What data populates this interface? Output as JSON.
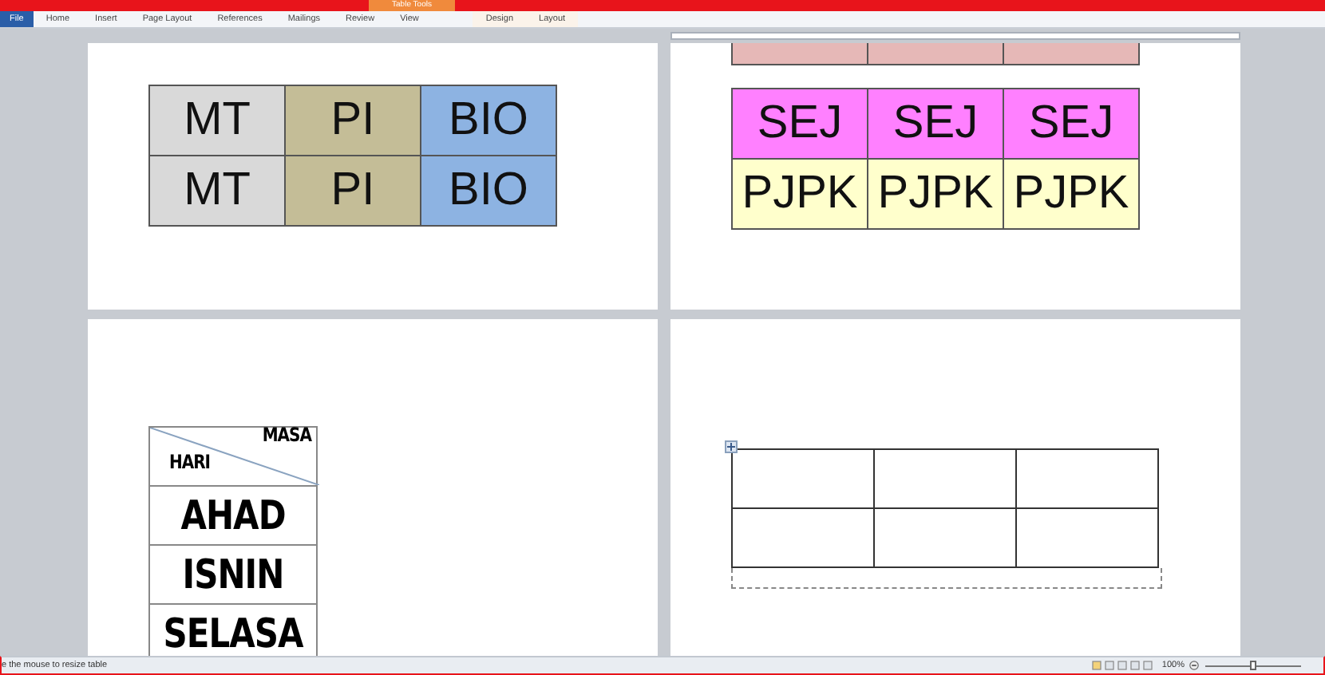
{
  "title_bar": {
    "context_group": "Table Tools"
  },
  "ribbon": {
    "tabs": [
      {
        "label": "File",
        "kind": "file",
        "selected": false
      },
      {
        "label": "Home",
        "kind": "normal",
        "selected": false
      },
      {
        "label": "Insert",
        "kind": "normal",
        "selected": false
      },
      {
        "label": "Page Layout",
        "kind": "normal",
        "selected": false
      },
      {
        "label": "References",
        "kind": "normal",
        "selected": false
      },
      {
        "label": "Mailings",
        "kind": "normal",
        "selected": false
      },
      {
        "label": "Review",
        "kind": "normal",
        "selected": false
      },
      {
        "label": "View",
        "kind": "normal",
        "selected": false
      },
      {
        "label": "Design",
        "kind": "contextual",
        "selected": false
      },
      {
        "label": "Layout",
        "kind": "contextual",
        "selected": false
      }
    ]
  },
  "pages": [
    {
      "tables": [
        {
          "kind": "large",
          "rows": [
            [
              {
                "kind": "text",
                "text": "MT",
                "color": "#d9d9d9"
              },
              {
                "kind": "text",
                "text": "PI",
                "color": "#c4bd97"
              },
              {
                "kind": "text",
                "text": "BIO",
                "color": "#8db3e2"
              }
            ],
            [
              {
                "kind": "text",
                "text": "MT",
                "color": "#d9d9d9"
              },
              {
                "kind": "text",
                "text": "PI",
                "color": "#c4bd97"
              },
              {
                "kind": "text",
                "text": "BIO",
                "color": "#8db3e2"
              }
            ]
          ]
        }
      ]
    },
    {
      "tables": [
        {
          "kind": "strip",
          "rows": [
            [
              {
                "kind": "empty",
                "color": "#e6b8b7"
              },
              {
                "kind": "empty",
                "color": "#e6b8b7"
              },
              {
                "kind": "empty",
                "color": "#e6b8b7"
              }
            ]
          ]
        },
        {
          "kind": "large",
          "rows": [
            [
              {
                "kind": "text",
                "text": "SEJ",
                "color": "#ff80ff"
              },
              {
                "kind": "text",
                "text": "SEJ",
                "color": "#ff80ff"
              },
              {
                "kind": "text",
                "text": "SEJ",
                "color": "#ff80ff"
              }
            ],
            [
              {
                "kind": "text",
                "text": "PJPK",
                "color": "#ffffcc"
              },
              {
                "kind": "text",
                "text": "PJPK",
                "color": "#ffffcc"
              },
              {
                "kind": "text",
                "text": "PJPK",
                "color": "#ffffcc"
              }
            ]
          ]
        }
      ]
    },
    {
      "tables": [
        {
          "kind": "heavy",
          "rows": [
            [
              {
                "kind": "diagonal",
                "top": "MASA",
                "bottom": "HARI"
              }
            ],
            [
              {
                "kind": "text",
                "text": "AHAD"
              }
            ],
            [
              {
                "kind": "text",
                "text": "ISNIN"
              }
            ],
            [
              {
                "kind": "text",
                "text": "SELASA"
              }
            ]
          ]
        }
      ]
    },
    {
      "tables": [
        {
          "kind": "blank",
          "move_handle": true,
          "rows": [
            [
              {
                "kind": "empty"
              },
              {
                "kind": "empty"
              },
              {
                "kind": "empty"
              }
            ],
            [
              {
                "kind": "empty"
              },
              {
                "kind": "empty"
              },
              {
                "kind": "empty"
              }
            ]
          ]
        }
      ]
    }
  ],
  "status_bar": {
    "message": "e the mouse to resize table",
    "zoom": "100%",
    "zoom_slider": {
      "level": 0.5
    }
  }
}
